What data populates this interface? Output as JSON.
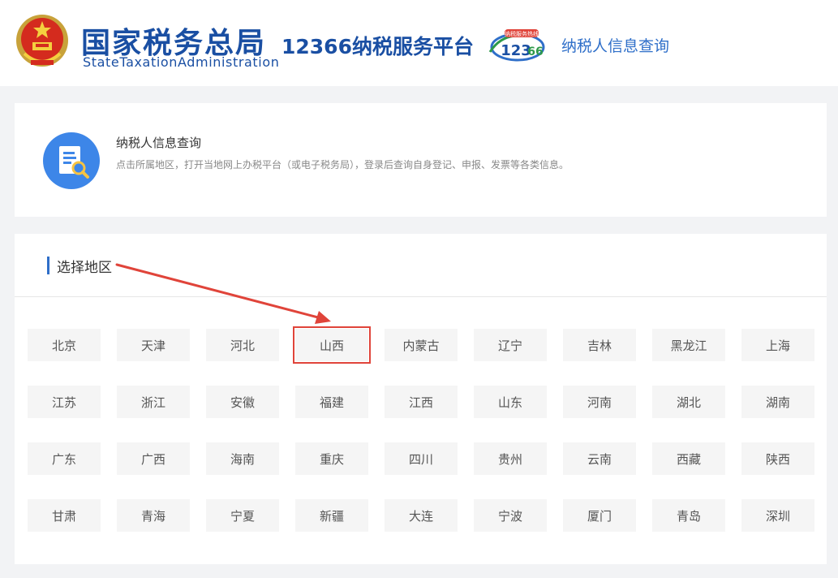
{
  "header": {
    "brand_cn": "国家税务总局",
    "brand_en": "StateTaxationAdministration",
    "platform_title": "12366纳税服务平台",
    "link_label": "纳税人信息查询",
    "logo_caption": "纳税服务热线"
  },
  "intro": {
    "title": "纳税人信息查询",
    "description": "点击所属地区，打开当地网上办税平台（或电子税务局），登录后查询自身登记、申报、发票等各类信息。"
  },
  "region_section": {
    "title": "选择地区",
    "highlighted_region": "山西",
    "regions": [
      "北京",
      "天津",
      "河北",
      "山西",
      "内蒙古",
      "辽宁",
      "吉林",
      "黑龙江",
      "上海",
      "江苏",
      "浙江",
      "安徽",
      "福建",
      "江西",
      "山东",
      "河南",
      "湖北",
      "湖南",
      "广东",
      "广西",
      "海南",
      "重庆",
      "四川",
      "贵州",
      "云南",
      "西藏",
      "陕西",
      "甘肃",
      "青海",
      "宁夏",
      "新疆",
      "大连",
      "宁波",
      "厦门",
      "青岛",
      "深圳"
    ]
  },
  "colors": {
    "brand_blue": "#1a4fa3",
    "link_blue": "#2f6fc9",
    "annotation_red": "#e0443a",
    "page_bg": "#f2f3f5"
  }
}
